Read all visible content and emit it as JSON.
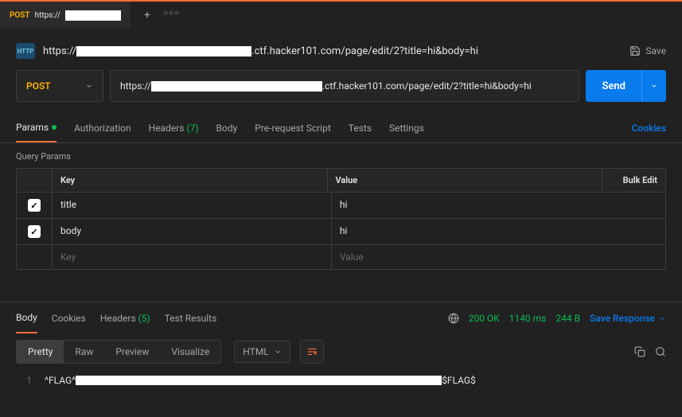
{
  "tab": {
    "method": "POST",
    "url_prefix": "https://"
  },
  "header": {
    "http_badge": "HTTP",
    "url_prefix": "https://",
    "url_suffix": ".ctf.hacker101.com/page/edit/2?title=hi&body=hi",
    "save_label": "Save"
  },
  "request": {
    "method": "POST",
    "url_prefix": "https://",
    "url_suffix": ".ctf.hacker101.com/page/edit/2?title=hi&body=hi",
    "send_label": "Send"
  },
  "req_tabs": {
    "params": "Params",
    "authorization": "Authorization",
    "headers": "Headers",
    "headers_count": "(7)",
    "body": "Body",
    "prerequest": "Pre-request Script",
    "tests": "Tests",
    "settings": "Settings",
    "cookies": "Cookies"
  },
  "query_params": {
    "section_label": "Query Params",
    "key_header": "Key",
    "value_header": "Value",
    "bulk_edit": "Bulk Edit",
    "key_placeholder": "Key",
    "value_placeholder": "Value",
    "rows": [
      {
        "key": "title",
        "value": "hi"
      },
      {
        "key": "body",
        "value": "hi"
      }
    ]
  },
  "response": {
    "body": "Body",
    "cookies": "Cookies",
    "headers": "Headers",
    "headers_count": "(5)",
    "test_results": "Test Results",
    "status": "200 OK",
    "time": "1140 ms",
    "size": "244 B",
    "save_response": "Save Response"
  },
  "viewer": {
    "pretty": "Pretty",
    "raw": "Raw",
    "preview": "Preview",
    "visualize": "Visualize",
    "lang": "HTML"
  },
  "code": {
    "line_num": "1",
    "flag_prefix": "^FLAG^",
    "flag_suffix": "$FLAG$"
  }
}
